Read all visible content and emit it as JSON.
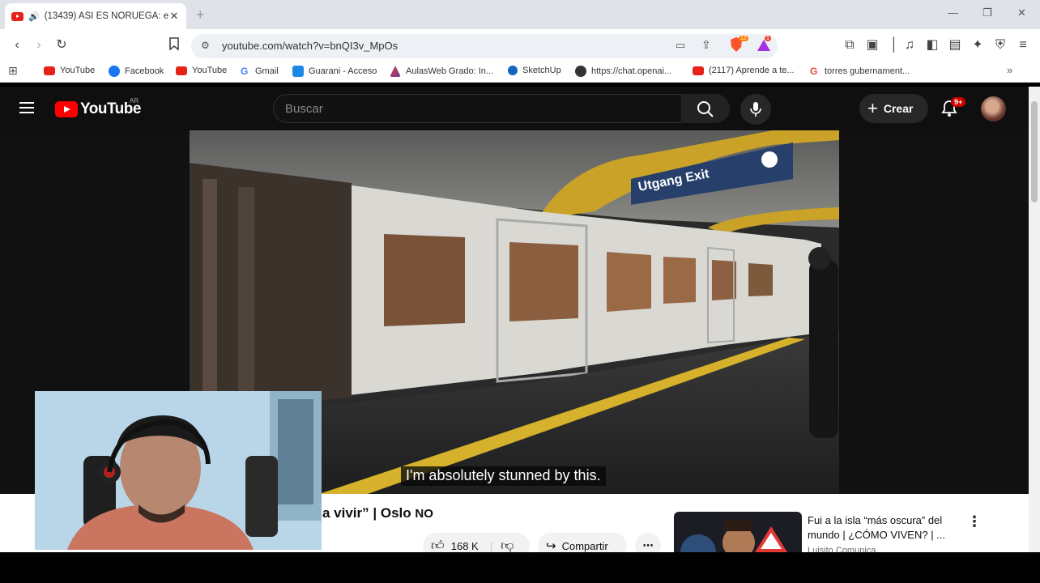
{
  "browser": {
    "tab": {
      "title": "(13439) ASÍ ES NORUEGA: el"
    },
    "url": "youtube.com/watch?v=bnQI3v_MpOs",
    "brave_badge": "12",
    "notif_badge": "1"
  },
  "bookmarks": [
    {
      "label": "YouTube",
      "icon": "youtube-icon",
      "color": "#e62117"
    },
    {
      "label": "Facebook",
      "icon": "facebook-icon",
      "color": "#1877f2"
    },
    {
      "label": "YouTube",
      "icon": "youtube-icon",
      "color": "#e62117"
    },
    {
      "label": "Gmail",
      "icon": "google-icon",
      "color": "#4285f4"
    },
    {
      "label": "Guarani - Acceso",
      "icon": "guarani-icon",
      "color": "#1e88e5"
    },
    {
      "label": "AulasWeb Grado: In...",
      "icon": "moodle-icon",
      "color": "#6a3d9a"
    },
    {
      "label": "SketchUp",
      "icon": "sketchup-icon",
      "color": "#1565c0"
    },
    {
      "label": "https://chat.openai...",
      "icon": "openai-icon",
      "color": "#333333"
    },
    {
      "label": "(2117) Aprende a te...",
      "icon": "youtube-icon",
      "color": "#e62117"
    },
    {
      "label": "torres gubernament...",
      "icon": "google-icon",
      "color": "#ea4335"
    }
  ],
  "youtube": {
    "region": "AR",
    "search_placeholder": "Buscar",
    "create_label": "Crear",
    "notifications_badge": "9+",
    "video": {
      "caption": "I'm absolutely stunned by this.",
      "sign_text": "Utgang Exit",
      "title_visible": "a vivir” | Oslo",
      "title_cc": "NO",
      "likes": "168 K",
      "share_label": "Compartir"
    },
    "recommended": {
      "title": "Fui a la isla “más oscura” del mundo | ¿CÓMO VIVEN? | ...",
      "channel": "Luisito Comunica"
    }
  }
}
